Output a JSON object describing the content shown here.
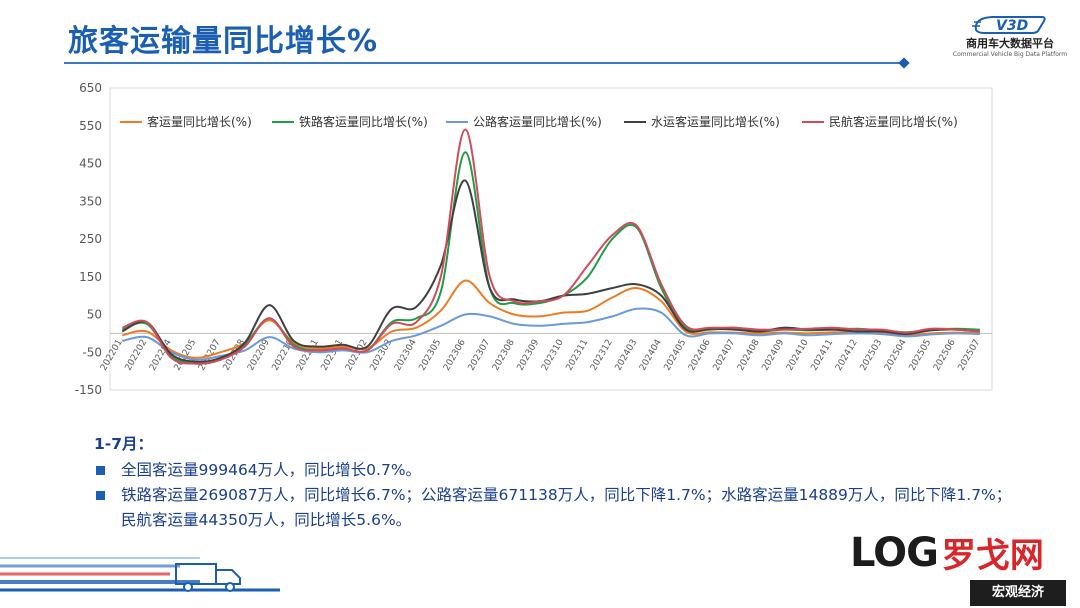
{
  "page": {
    "title": "旅客运输量同比增长%",
    "logo_cn": "商用车大数据平台",
    "logo_en": "Commercial Vehicle Big Data Platform",
    "logo_badge": "V3D",
    "log_brand_latin": "LOG",
    "log_brand_cn": "罗戈网",
    "footer_tag": "宏观经济"
  },
  "summary": {
    "head": "1-7月：",
    "bullets": [
      "全国客运量999464万人，同比增长0.7%。",
      "铁路客运量269087万人，同比增长6.7%；公路客运量671138万人，同比下降1.7%；水路客运量14889万人，同比下降1.7%；民航客运量44350万人，同比增长5.6%。"
    ]
  },
  "chart_data": {
    "type": "line",
    "ylim": [
      -150,
      650
    ],
    "yticks": [
      -150,
      -50,
      50,
      150,
      250,
      350,
      450,
      550,
      650
    ],
    "grid": false,
    "legend_position": "top",
    "x_tick_labels": [
      "202201",
      "202202",
      "202204",
      "202205",
      "202207",
      "202208",
      "202209",
      "202210",
      "202211",
      "202301",
      "202302",
      "202303",
      "202304",
      "202305",
      "202306",
      "202307",
      "202308",
      "202309",
      "202310",
      "202311",
      "202312",
      "202403",
      "202404",
      "202405",
      "202406",
      "202407",
      "202408",
      "202409",
      "202410",
      "202411",
      "202412",
      "202503",
      "202504",
      "202505",
      "202506",
      "202507"
    ],
    "series": [
      {
        "name": "客运量同比增长(%)",
        "color": "#f07a22",
        "values": [
          -5,
          5,
          -45,
          -65,
          -50,
          -25,
          35,
          -25,
          -40,
          -35,
          -40,
          5,
          15,
          60,
          140,
          80,
          50,
          45,
          55,
          60,
          95,
          120,
          85,
          5,
          3,
          2,
          0,
          2,
          0,
          3,
          2,
          2,
          -5,
          0,
          2,
          1
        ]
      },
      {
        "name": "铁路客运量同比增长(%)",
        "color": "#1f9e4a",
        "values": [
          10,
          25,
          -60,
          -80,
          -70,
          -30,
          40,
          -30,
          -45,
          -40,
          -45,
          30,
          40,
          110,
          480,
          120,
          80,
          80,
          100,
          150,
          250,
          280,
          120,
          15,
          10,
          15,
          5,
          10,
          8,
          10,
          12,
          8,
          3,
          10,
          12,
          10
        ]
      },
      {
        "name": "公路客运量同比增长(%)",
        "color": "#6a9ad8",
        "values": [
          -20,
          -10,
          -50,
          -70,
          -60,
          -45,
          -10,
          -40,
          -50,
          -45,
          -50,
          -20,
          -5,
          20,
          50,
          45,
          25,
          20,
          25,
          30,
          45,
          65,
          55,
          -5,
          0,
          0,
          -5,
          0,
          -5,
          -2,
          0,
          -2,
          -8,
          -3,
          0,
          -2
        ]
      },
      {
        "name": "水运客运量同比增长(%)",
        "color": "#404040",
        "values": [
          5,
          30,
          -55,
          -75,
          -65,
          -25,
          75,
          -20,
          -35,
          -30,
          -35,
          65,
          70,
          180,
          405,
          120,
          90,
          85,
          100,
          105,
          120,
          130,
          100,
          10,
          12,
          10,
          5,
          15,
          10,
          10,
          5,
          5,
          -2,
          8,
          10,
          5
        ]
      },
      {
        "name": "民航客运量同比增长(%)",
        "color": "#d24b5a",
        "values": [
          15,
          30,
          -65,
          -80,
          -70,
          -35,
          40,
          -35,
          -45,
          -40,
          -45,
          25,
          30,
          150,
          540,
          150,
          85,
          85,
          100,
          180,
          260,
          285,
          130,
          20,
          15,
          15,
          10,
          10,
          12,
          15,
          10,
          10,
          2,
          12,
          10,
          5
        ]
      }
    ]
  }
}
